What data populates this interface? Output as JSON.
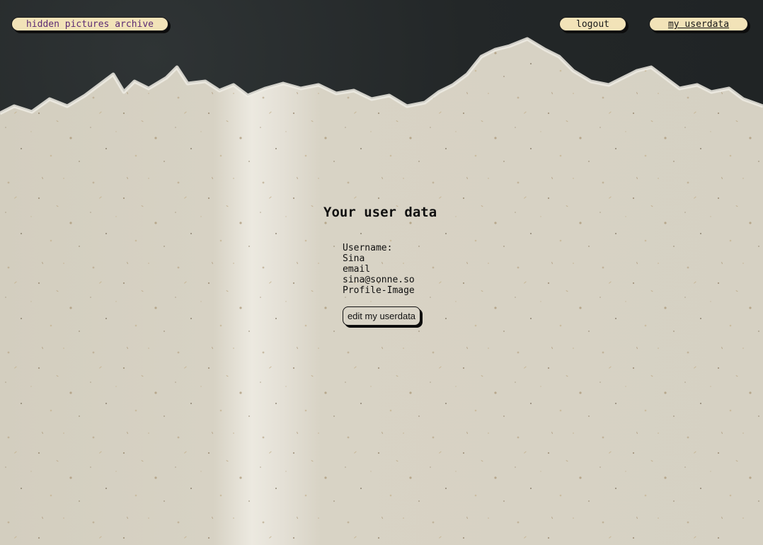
{
  "nav": {
    "home_label": "hidden pictures archive",
    "logout_label": "logout",
    "userdata_label": "my userdata"
  },
  "main": {
    "title": "Your user data",
    "username_label": "Username:",
    "username_value": "Sina",
    "email_label": "email",
    "email_value": "sina@sonne.so",
    "profile_image_label": "Profile-Image",
    "edit_button_label": "edit my userdata"
  },
  "colors": {
    "backdrop": "#232728",
    "paper": "#d9d4c7",
    "pill": "#f2e3b8",
    "home_link_text": "#5b2a73"
  }
}
